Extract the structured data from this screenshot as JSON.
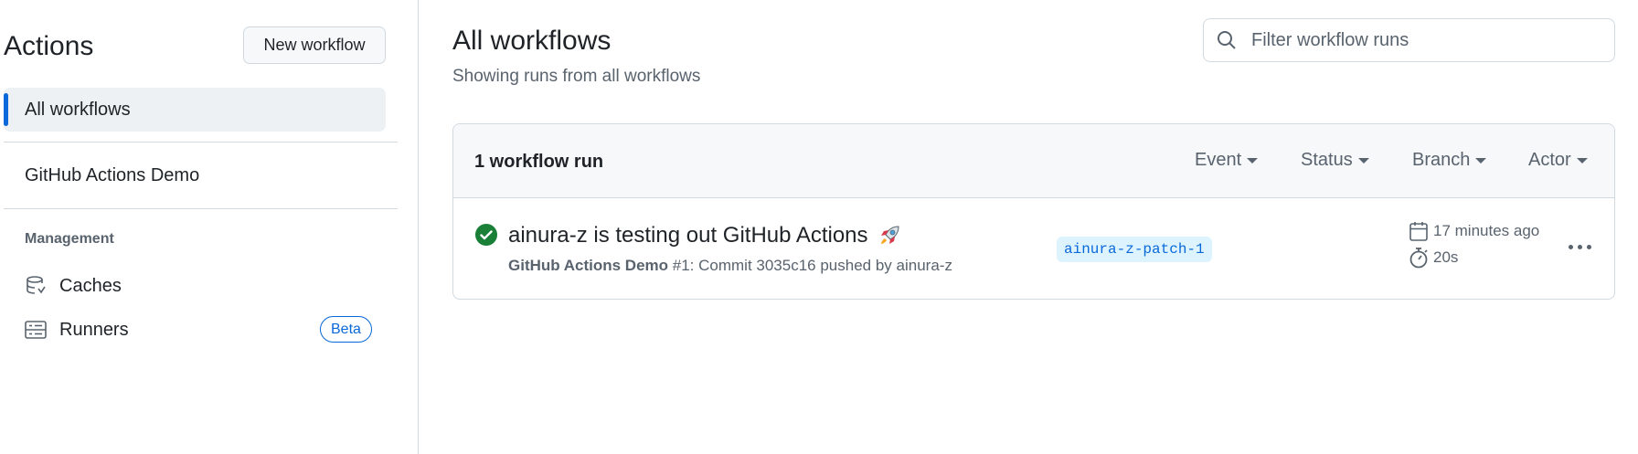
{
  "sidebar": {
    "title": "Actions",
    "new_workflow_label": "New workflow",
    "all_workflows_label": "All workflows",
    "workflows": [
      "GitHub Actions Demo"
    ],
    "management_heading": "Management",
    "management_items": [
      {
        "label": "Caches",
        "icon": "database-icon"
      },
      {
        "label": "Runners",
        "icon": "server-icon",
        "badge": "Beta"
      }
    ]
  },
  "main": {
    "title": "All workflows",
    "subtitle": "Showing runs from all workflows",
    "filter_placeholder": "Filter workflow runs",
    "runs_count_label": "1 workflow run",
    "filters": [
      "Event",
      "Status",
      "Branch",
      "Actor"
    ],
    "runs": [
      {
        "title": "ainura-z is testing out GitHub Actions",
        "workflow": "GitHub Actions Demo",
        "meta_rest": " #1: Commit 3035c16 pushed by ainura-z",
        "branch": "ainura-z-patch-1",
        "time_ago": "17 minutes ago",
        "duration": "20s",
        "status": "success"
      }
    ]
  },
  "colors": {
    "accent": "#0969da",
    "success": "#1a7f37",
    "branch_bg": "#ddf4ff",
    "border": "#d1d9e0",
    "muted": "#59636e"
  }
}
